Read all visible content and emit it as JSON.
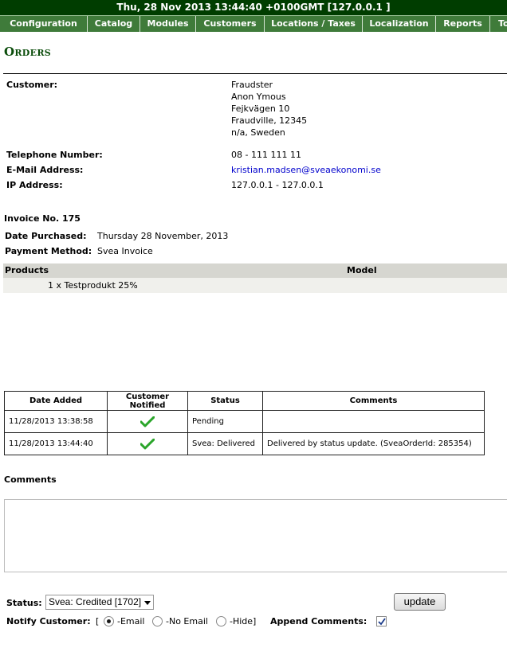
{
  "header": {
    "datetime": "Thu, 28 Nov 2013 13:44:40 +0100GMT [127.0.0.1 ]"
  },
  "nav": {
    "items": [
      {
        "label": "Configuration"
      },
      {
        "label": "Catalog"
      },
      {
        "label": "Modules"
      },
      {
        "label": "Customers"
      },
      {
        "label": "Locations / Taxes"
      },
      {
        "label": "Localization"
      },
      {
        "label": "Reports"
      },
      {
        "label": "To"
      }
    ]
  },
  "page": {
    "title": "Orders"
  },
  "customer": {
    "label": "Customer:",
    "name": "Fraudster",
    "line2": "Anon Ymous",
    "street": "Fejkvägen 10",
    "city": "Fraudville, 12345",
    "region": "n/a, Sweden",
    "phone_label": "Telephone Number:",
    "phone": "08 - 111 111 11",
    "email_label": "E-Mail Address:",
    "email": "kristian.madsen@sveaekonomi.se",
    "ip_label": "IP Address:",
    "ip": "127.0.0.1 - 127.0.0.1"
  },
  "order": {
    "invoice": "Invoice No. 175",
    "date_label": "Date Purchased:",
    "date": "Thursday 28 November, 2013",
    "payment_label": "Payment Method:",
    "payment": "Svea Invoice"
  },
  "products": {
    "col_products": "Products",
    "col_model": "Model",
    "rows": [
      {
        "item": "1 x Testprodukt 25%"
      }
    ]
  },
  "history": {
    "headers": [
      "Date Added",
      "Customer Notified",
      "Status",
      "Comments"
    ],
    "rows": [
      {
        "date": "11/28/2013 13:38:58",
        "notified": "check-icon",
        "status": "Pending",
        "comment": ""
      },
      {
        "date": "11/28/2013 13:44:40",
        "notified": "check-icon",
        "status": "Svea: Delivered",
        "comment": "Delivered by status update. (SveaOrderId: 285354)"
      }
    ]
  },
  "form": {
    "comments_label": "Comments",
    "comments_value": "",
    "status_label": "Status:",
    "status_selected": "Svea: Credited [1702]",
    "update_label": "update",
    "notify_label": "Notify Customer:",
    "bracket_open": "[",
    "opt_email": "-Email",
    "opt_no_email": "-No Email",
    "opt_hide": "-Hide]",
    "append_label": "Append Comments:",
    "check_color": "#2aa52a",
    "selected_option": "-Email",
    "append_checked": true
  }
}
